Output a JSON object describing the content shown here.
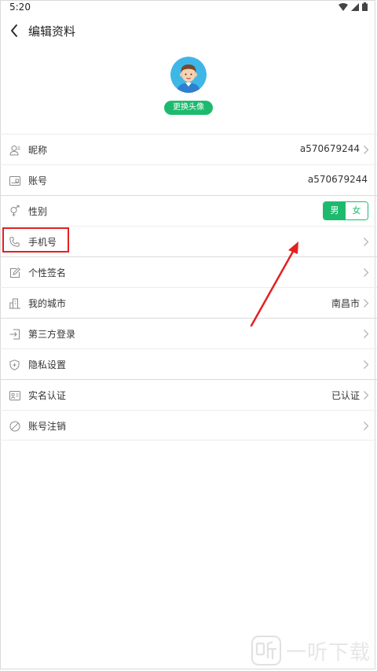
{
  "status": {
    "time": "5:20"
  },
  "header": {
    "title": "编辑资料"
  },
  "avatar": {
    "change_label": "更换头像"
  },
  "rows": [
    {
      "label": "昵称",
      "value": "a570679244",
      "icon": "user-icon",
      "chevron": true
    },
    {
      "label": "账号",
      "value": "a570679244",
      "icon": "id-card-icon",
      "chevron": false
    },
    {
      "label": "性别",
      "value": "",
      "icon": "gender-icon",
      "chevron": false
    },
    {
      "label": "手机号",
      "value": "",
      "icon": "phone-icon",
      "chevron": true
    },
    {
      "label": "个性签名",
      "value": "",
      "icon": "edit-icon",
      "chevron": true
    },
    {
      "label": "我的城市",
      "value": "南昌市",
      "icon": "city-icon",
      "chevron": true
    },
    {
      "label": "第三方登录",
      "value": "",
      "icon": "login-icon",
      "chevron": true
    },
    {
      "label": "隐私设置",
      "value": "",
      "icon": "shield-icon",
      "chevron": true
    },
    {
      "label": "实名认证",
      "value": "已认证",
      "icon": "id-verify-icon",
      "chevron": true
    },
    {
      "label": "账号注销",
      "value": "",
      "icon": "ban-icon",
      "chevron": true
    }
  ],
  "gender": {
    "male": "男",
    "female": "女",
    "selected": "男"
  },
  "watermark": {
    "text": "一听下载"
  },
  "colors": {
    "accent": "#1dba6e",
    "highlight": "#e52020"
  }
}
